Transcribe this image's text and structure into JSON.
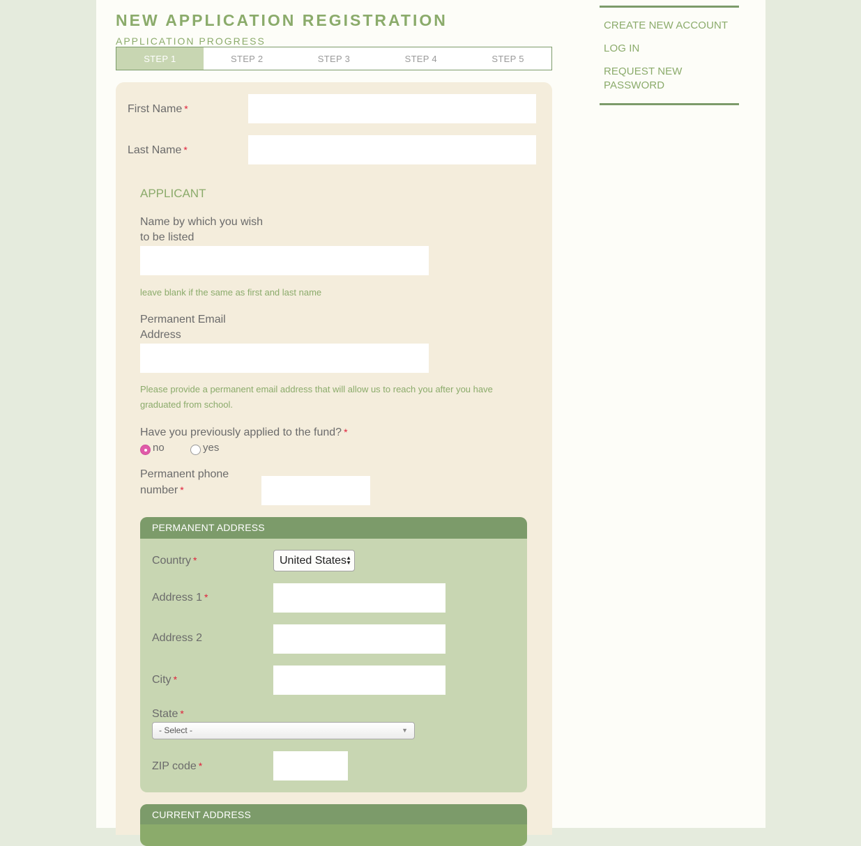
{
  "header": {
    "title": "NEW APPLICATION REGISTRATION",
    "progress_label": "APPLICATION PROGRESS",
    "steps": [
      {
        "label": "STEP 1",
        "active": true
      },
      {
        "label": "STEP 2",
        "active": false
      },
      {
        "label": "STEP 3",
        "active": false
      },
      {
        "label": "STEP 4",
        "active": false
      },
      {
        "label": "STEP 5",
        "active": false
      }
    ]
  },
  "sidebar": {
    "links": [
      "CREATE NEW ACCOUNT",
      "LOG IN",
      "REQUEST NEW PASSWORD"
    ]
  },
  "form": {
    "required_marker": "*",
    "first_name": {
      "label": "First Name",
      "value": ""
    },
    "last_name": {
      "label": "Last Name",
      "value": ""
    },
    "applicant": {
      "heading": "APPLICANT",
      "listed_name": {
        "label_line1": "Name by which you wish",
        "label_line2": "to be listed",
        "value": "",
        "hint": "leave blank if the same as first and last name"
      },
      "email": {
        "label_line1": "Permanent Email",
        "label_line2": "Address",
        "value": "",
        "hint": "Please provide a permanent email address that will allow us to reach you after you have graduated from school."
      },
      "applied_before": {
        "label": "Have you previously applied to the fund?",
        "options": [
          {
            "label": "no",
            "checked": true
          },
          {
            "label": "yes",
            "checked": false
          }
        ]
      },
      "phone": {
        "label_line1": "Permanent phone",
        "label_line2": "number",
        "value": ""
      }
    },
    "permanent_address": {
      "heading": "PERMANENT ADDRESS",
      "country": {
        "label": "Country",
        "value": "United States"
      },
      "address1": {
        "label": "Address 1",
        "value": ""
      },
      "address2": {
        "label": "Address 2",
        "value": ""
      },
      "city": {
        "label": "City",
        "value": ""
      },
      "state": {
        "label": "State",
        "value": "- Select -"
      },
      "zip": {
        "label": "ZIP code",
        "value": ""
      }
    },
    "current_address": {
      "heading": "CURRENT ADDRESS"
    }
  },
  "colors": {
    "brand_green": "#8bab6b",
    "dark_green": "#7c9b6a",
    "light_green": "#c8d6b2",
    "form_bg": "#f4eddc",
    "required_red": "#e0203a",
    "radio_pink": "#e05ba9"
  }
}
